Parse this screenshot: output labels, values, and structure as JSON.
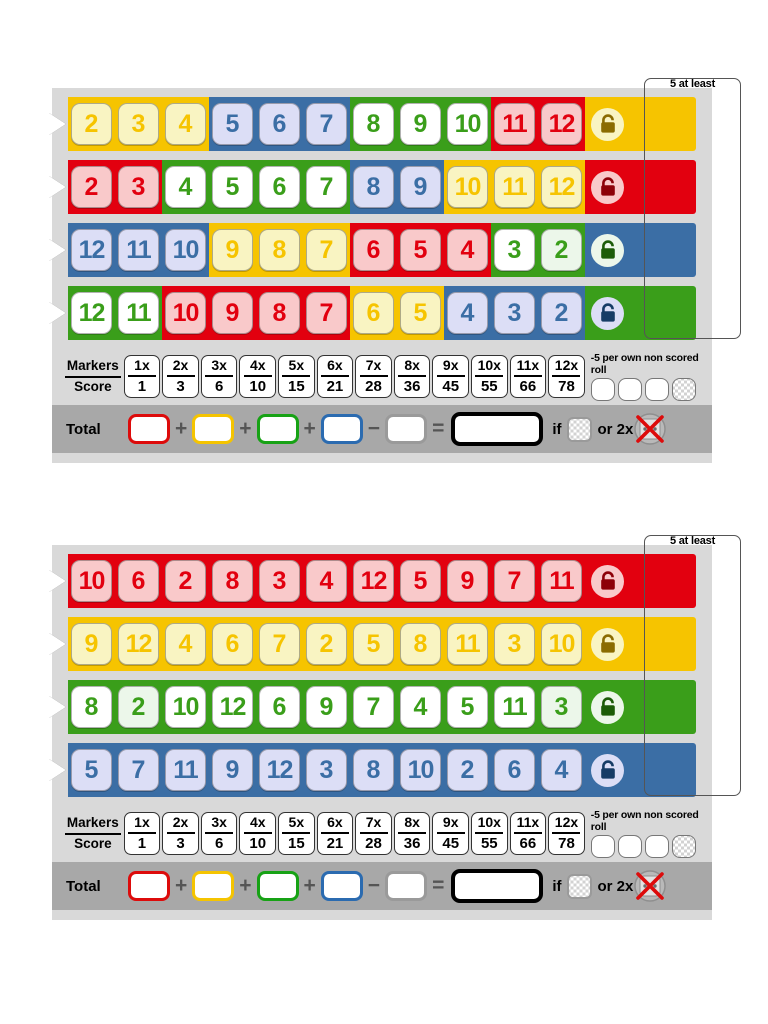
{
  "meta": {
    "game_title": "Qwixx-style dice score sheet",
    "bracket_label": "5 at least",
    "lock_icon": "padlock-icon",
    "arrow_icon": "row-start-arrow-icon",
    "die_icon": "crossed-out-die-icon"
  },
  "palette": {
    "red": "#e2000f",
    "yellow": "#f6c400",
    "green": "#3a9e1a",
    "blue": "#3b6ea5",
    "red_cell": "#f9c9ca",
    "yellow_cell": "#f9f4c2",
    "green_cell": "#ecf7ea",
    "blue_cell": "#dcdef6",
    "white_cell": "#ffffff",
    "red_text": "#e2000f",
    "yellow_text": "#f6c400",
    "green_text": "#3a9e1a",
    "blue_text": "#3b6ea5",
    "card_bg": "#d9d9d9",
    "total_bg": "#a8a8a8"
  },
  "markers_strip": {
    "markers_label": "Markers",
    "score_label": "Score",
    "columns": [
      {
        "markers": "1x",
        "score": "1"
      },
      {
        "markers": "2x",
        "score": "3"
      },
      {
        "markers": "3x",
        "score": "6"
      },
      {
        "markers": "4x",
        "score": "10"
      },
      {
        "markers": "5x",
        "score": "15"
      },
      {
        "markers": "6x",
        "score": "21"
      },
      {
        "markers": "7x",
        "score": "28"
      },
      {
        "markers": "8x",
        "score": "36"
      },
      {
        "markers": "9x",
        "score": "45"
      },
      {
        "markers": "10x",
        "score": "55"
      },
      {
        "markers": "11x",
        "score": "66"
      },
      {
        "markers": "12x",
        "score": "78"
      }
    ],
    "penalty_text": "-5 per own non scored roll",
    "penalty_boxes": [
      "plain",
      "plain",
      "plain",
      "hatched"
    ]
  },
  "total_strip": {
    "total_label": "Total",
    "boxes": [
      "red",
      "yellow",
      "green",
      "blue",
      "gray"
    ],
    "operators": [
      "+",
      "+",
      "+",
      "−"
    ],
    "equals": "=",
    "grand_total_value": "",
    "if_label": "if",
    "or_label": "or 2x"
  },
  "cards": [
    {
      "id": "card-1",
      "name": "ordered-number-card",
      "rows": [
        {
          "name": "row-yellow",
          "track_color": "yellow",
          "lock_circle": "#f6c400",
          "lock_inner": "#f9f4c2",
          "lock_glyph": "#8a6b00",
          "cells": [
            {
              "value": "2",
              "bg": "yellow",
              "text": "yellow",
              "seg": "yellow"
            },
            {
              "value": "3",
              "bg": "yellow",
              "text": "yellow",
              "seg": "yellow"
            },
            {
              "value": "4",
              "bg": "yellow",
              "text": "yellow",
              "seg": "yellow"
            },
            {
              "value": "5",
              "bg": "blue",
              "text": "blue",
              "seg": "blue"
            },
            {
              "value": "6",
              "bg": "blue",
              "text": "blue",
              "seg": "blue"
            },
            {
              "value": "7",
              "bg": "blue",
              "text": "blue",
              "seg": "blue"
            },
            {
              "value": "8",
              "bg": "white",
              "text": "green",
              "seg": "green"
            },
            {
              "value": "9",
              "bg": "white",
              "text": "green",
              "seg": "green"
            },
            {
              "value": "10",
              "bg": "white",
              "text": "green",
              "seg": "green"
            },
            {
              "value": "11",
              "bg": "red",
              "text": "red",
              "seg": "red"
            },
            {
              "value": "12",
              "bg": "red",
              "text": "red",
              "seg": "red"
            }
          ]
        },
        {
          "name": "row-red",
          "track_color": "red",
          "lock_circle": "#e2000f",
          "lock_inner": "#f9c9ca",
          "lock_glyph": "#8d0008",
          "cells": [
            {
              "value": "2",
              "bg": "red",
              "text": "red",
              "seg": "red"
            },
            {
              "value": "3",
              "bg": "red",
              "text": "red",
              "seg": "red"
            },
            {
              "value": "4",
              "bg": "white",
              "text": "green",
              "seg": "green"
            },
            {
              "value": "5",
              "bg": "white",
              "text": "green",
              "seg": "green"
            },
            {
              "value": "6",
              "bg": "white",
              "text": "green",
              "seg": "green"
            },
            {
              "value": "7",
              "bg": "white",
              "text": "green",
              "seg": "green"
            },
            {
              "value": "8",
              "bg": "blue",
              "text": "blue",
              "seg": "blue"
            },
            {
              "value": "9",
              "bg": "blue",
              "text": "blue",
              "seg": "blue"
            },
            {
              "value": "10",
              "bg": "yellow",
              "text": "yellow",
              "seg": "yellow"
            },
            {
              "value": "11",
              "bg": "yellow",
              "text": "yellow",
              "seg": "yellow"
            },
            {
              "value": "12",
              "bg": "yellow",
              "text": "yellow",
              "seg": "yellow"
            }
          ]
        },
        {
          "name": "row-blue",
          "track_color": "blue",
          "lock_circle": "#3a9e1a",
          "lock_inner": "#ecf7ea",
          "lock_glyph": "#1c5c08",
          "cells": [
            {
              "value": "12",
              "bg": "blue",
              "text": "blue",
              "seg": "blue"
            },
            {
              "value": "11",
              "bg": "blue",
              "text": "blue",
              "seg": "blue"
            },
            {
              "value": "10",
              "bg": "blue",
              "text": "blue",
              "seg": "blue"
            },
            {
              "value": "9",
              "bg": "yellow",
              "text": "yellow",
              "seg": "yellow"
            },
            {
              "value": "8",
              "bg": "yellow",
              "text": "yellow",
              "seg": "yellow"
            },
            {
              "value": "7",
              "bg": "yellow",
              "text": "yellow",
              "seg": "yellow"
            },
            {
              "value": "6",
              "bg": "red",
              "text": "red",
              "seg": "red"
            },
            {
              "value": "5",
              "bg": "red",
              "text": "red",
              "seg": "red"
            },
            {
              "value": "4",
              "bg": "red",
              "text": "red",
              "seg": "red"
            },
            {
              "value": "3",
              "bg": "white",
              "text": "green",
              "seg": "green"
            },
            {
              "value": "2",
              "bg": "green",
              "text": "green",
              "seg": "green"
            }
          ]
        },
        {
          "name": "row-green",
          "track_color": "green",
          "lock_circle": "#3b6ea5",
          "lock_inner": "#dcdef6",
          "lock_glyph": "#173c66",
          "cells": [
            {
              "value": "12",
              "bg": "white",
              "text": "green",
              "seg": "green"
            },
            {
              "value": "11",
              "bg": "white",
              "text": "green",
              "seg": "green"
            },
            {
              "value": "10",
              "bg": "red",
              "text": "red",
              "seg": "red"
            },
            {
              "value": "9",
              "bg": "red",
              "text": "red",
              "seg": "red"
            },
            {
              "value": "8",
              "bg": "red",
              "text": "red",
              "seg": "red"
            },
            {
              "value": "7",
              "bg": "red",
              "text": "red",
              "seg": "red"
            },
            {
              "value": "6",
              "bg": "yellow",
              "text": "yellow",
              "seg": "yellow"
            },
            {
              "value": "5",
              "bg": "yellow",
              "text": "yellow",
              "seg": "yellow"
            },
            {
              "value": "4",
              "bg": "blue",
              "text": "blue",
              "seg": "blue"
            },
            {
              "value": "3",
              "bg": "blue",
              "text": "blue",
              "seg": "blue"
            },
            {
              "value": "2",
              "bg": "blue",
              "text": "blue",
              "seg": "blue"
            }
          ]
        }
      ]
    },
    {
      "id": "card-2",
      "name": "shuffled-number-card",
      "rows": [
        {
          "name": "row-red",
          "track_color": "red",
          "lock_circle": "#e2000f",
          "lock_inner": "#f9c9ca",
          "lock_glyph": "#8d0008",
          "cells": [
            {
              "value": "10",
              "bg": "red",
              "text": "red",
              "seg": "red"
            },
            {
              "value": "6",
              "bg": "red",
              "text": "red",
              "seg": "red"
            },
            {
              "value": "2",
              "bg": "red",
              "text": "red",
              "seg": "red"
            },
            {
              "value": "8",
              "bg": "red",
              "text": "red",
              "seg": "red"
            },
            {
              "value": "3",
              "bg": "red",
              "text": "red",
              "seg": "red"
            },
            {
              "value": "4",
              "bg": "red",
              "text": "red",
              "seg": "red"
            },
            {
              "value": "12",
              "bg": "red",
              "text": "red",
              "seg": "red"
            },
            {
              "value": "5",
              "bg": "red",
              "text": "red",
              "seg": "red"
            },
            {
              "value": "9",
              "bg": "red",
              "text": "red",
              "seg": "red"
            },
            {
              "value": "7",
              "bg": "red",
              "text": "red",
              "seg": "red"
            },
            {
              "value": "11",
              "bg": "red",
              "text": "red",
              "seg": "red"
            }
          ]
        },
        {
          "name": "row-yellow",
          "track_color": "yellow",
          "lock_circle": "#f6c400",
          "lock_inner": "#f9f4c2",
          "lock_glyph": "#8a6b00",
          "cells": [
            {
              "value": "9",
              "bg": "yellow",
              "text": "yellow",
              "seg": "yellow"
            },
            {
              "value": "12",
              "bg": "yellow",
              "text": "yellow",
              "seg": "yellow"
            },
            {
              "value": "4",
              "bg": "yellow",
              "text": "yellow",
              "seg": "yellow"
            },
            {
              "value": "6",
              "bg": "yellow",
              "text": "yellow",
              "seg": "yellow"
            },
            {
              "value": "7",
              "bg": "yellow",
              "text": "yellow",
              "seg": "yellow"
            },
            {
              "value": "2",
              "bg": "yellow",
              "text": "yellow",
              "seg": "yellow"
            },
            {
              "value": "5",
              "bg": "yellow",
              "text": "yellow",
              "seg": "yellow"
            },
            {
              "value": "8",
              "bg": "yellow",
              "text": "yellow",
              "seg": "yellow"
            },
            {
              "value": "11",
              "bg": "yellow",
              "text": "yellow",
              "seg": "yellow"
            },
            {
              "value": "3",
              "bg": "yellow",
              "text": "yellow",
              "seg": "yellow"
            },
            {
              "value": "10",
              "bg": "yellow",
              "text": "yellow",
              "seg": "yellow"
            }
          ]
        },
        {
          "name": "row-green",
          "track_color": "green",
          "lock_circle": "#3a9e1a",
          "lock_inner": "#ecf7ea",
          "lock_glyph": "#1c5c08",
          "cells": [
            {
              "value": "8",
              "bg": "white",
              "text": "green",
              "seg": "green"
            },
            {
              "value": "2",
              "bg": "green",
              "text": "green",
              "seg": "green"
            },
            {
              "value": "10",
              "bg": "white",
              "text": "green",
              "seg": "green"
            },
            {
              "value": "12",
              "bg": "white",
              "text": "green",
              "seg": "green"
            },
            {
              "value": "6",
              "bg": "white",
              "text": "green",
              "seg": "green"
            },
            {
              "value": "9",
              "bg": "white",
              "text": "green",
              "seg": "green"
            },
            {
              "value": "7",
              "bg": "white",
              "text": "green",
              "seg": "green"
            },
            {
              "value": "4",
              "bg": "white",
              "text": "green",
              "seg": "green"
            },
            {
              "value": "5",
              "bg": "white",
              "text": "green",
              "seg": "green"
            },
            {
              "value": "11",
              "bg": "white",
              "text": "green",
              "seg": "green"
            },
            {
              "value": "3",
              "bg": "green",
              "text": "green",
              "seg": "green"
            }
          ]
        },
        {
          "name": "row-blue",
          "track_color": "blue",
          "lock_circle": "#3b6ea5",
          "lock_inner": "#dcdef6",
          "lock_glyph": "#173c66",
          "cells": [
            {
              "value": "5",
              "bg": "blue",
              "text": "blue",
              "seg": "blue"
            },
            {
              "value": "7",
              "bg": "blue",
              "text": "blue",
              "seg": "blue"
            },
            {
              "value": "11",
              "bg": "blue",
              "text": "blue",
              "seg": "blue"
            },
            {
              "value": "9",
              "bg": "blue",
              "text": "blue",
              "seg": "blue"
            },
            {
              "value": "12",
              "bg": "blue",
              "text": "blue",
              "seg": "blue"
            },
            {
              "value": "3",
              "bg": "blue",
              "text": "blue",
              "seg": "blue"
            },
            {
              "value": "8",
              "bg": "blue",
              "text": "blue",
              "seg": "blue"
            },
            {
              "value": "10",
              "bg": "blue",
              "text": "blue",
              "seg": "blue"
            },
            {
              "value": "2",
              "bg": "blue",
              "text": "blue",
              "seg": "blue"
            },
            {
              "value": "6",
              "bg": "blue",
              "text": "blue",
              "seg": "blue"
            },
            {
              "value": "4",
              "bg": "blue",
              "text": "blue",
              "seg": "blue"
            }
          ]
        }
      ]
    }
  ]
}
